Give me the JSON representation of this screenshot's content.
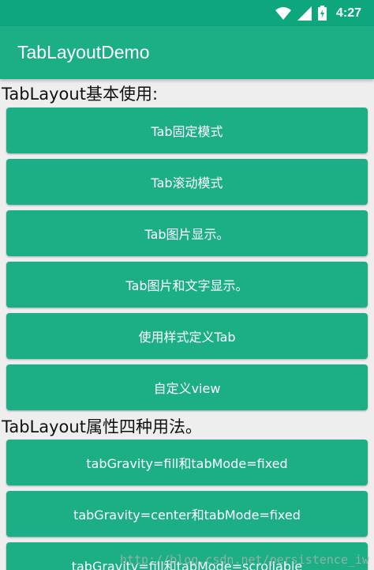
{
  "status_bar": {
    "time": "4:27",
    "icons": [
      "wifi-icon",
      "signal-icon",
      "battery-charging-icon"
    ]
  },
  "app_bar": {
    "title": "TabLayoutDemo"
  },
  "section_basic": {
    "title": "TabLayout基本使用:",
    "buttons": [
      "Tab固定模式",
      "Tab滚动模式",
      "Tab图片显示。",
      "Tab图片和文字显示。",
      "使用样式定义Tab",
      "自定义view"
    ]
  },
  "section_props": {
    "title": "TabLayout属性四种用法。",
    "buttons": [
      "tabGravity=fill和tabMode=fixed",
      "tabGravity=center和tabMode=fixed",
      "tabGravity=fill和tabMode=scrollable"
    ]
  },
  "watermark": "http://blog.csdn.net/persistence_iw",
  "colors": {
    "primary": "#1cae84",
    "primary_dark": "#0ea67c",
    "background": "#eeeeee"
  }
}
